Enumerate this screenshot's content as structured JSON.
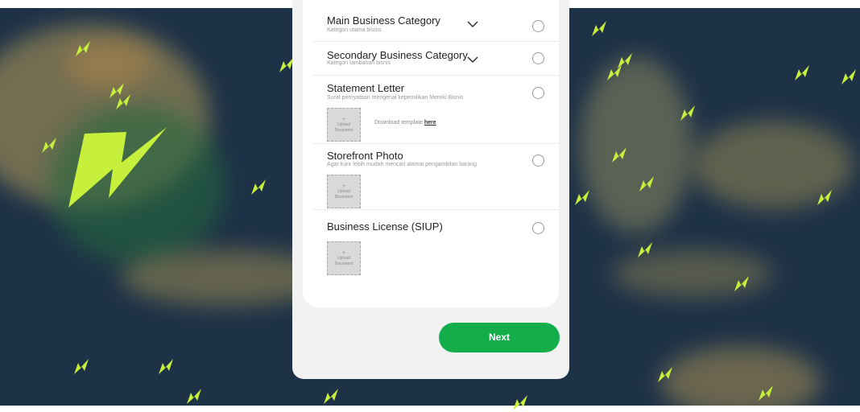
{
  "colors": {
    "map_sea": "#1d3147",
    "land": "#b29b52",
    "bolt": "#c7f03c",
    "accent_green": "#13ae4b",
    "card": "#ffffff"
  },
  "form": {
    "rows": [
      {
        "title": "Main Business Category",
        "subtitle": "Kategori utama bisnis",
        "control": "chevron-down-icon"
      },
      {
        "title": "Secondary Business Category",
        "subtitle": "Kategori tambahan bisnis",
        "control": "chevron-down-icon"
      },
      {
        "title": "Statement Letter",
        "subtitle": "Surat pernyataan mengenai kepemilikan Merek/ Bisnis",
        "upload": true,
        "download_text": "Download template",
        "download_link": "here"
      },
      {
        "title": "Storefront Photo",
        "subtitle": "Agar kurir lebih mudah mencari alamat pengambilan barang",
        "upload": true
      },
      {
        "title": "Business License (SIUP)",
        "subtitle": "",
        "upload": true
      }
    ],
    "upload_plus": "+",
    "upload_line1": "Upload",
    "upload_line2": "Document",
    "next_label": "Next"
  },
  "icons": {
    "background_bolt": "lightning-bolt-icon",
    "row_status": "radio-circle-icon",
    "dropdown": "chevron-down-icon"
  }
}
